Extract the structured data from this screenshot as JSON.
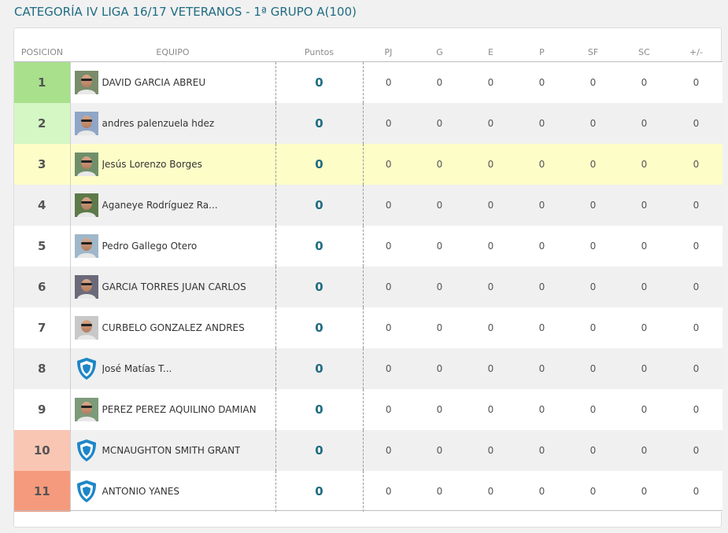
{
  "title": "CATEGORÍA IV LIGA 16/17 VETERANOS - 1ª GRUPO A(100)",
  "colors": {
    "title": "#1f6c82",
    "points": "#1f6c82",
    "highlight_row": "#fdfdc8",
    "pos_1": "#a9e08c",
    "pos_2": "#d4f7c4",
    "pos_10": "#f9c6b4",
    "pos_11": "#f59a7c"
  },
  "headers": {
    "posicion": "POSICION",
    "equipo": "EQUIPO",
    "puntos": "Puntos",
    "pj": "PJ",
    "g": "G",
    "e": "E",
    "p": "P",
    "sf": "SF",
    "sc": "SC",
    "diff": "+/-"
  },
  "rows": [
    {
      "pos": "1",
      "pos_bg": "#a9e08c",
      "team": "DAVID GARCIA ABREU",
      "avatar": "photo",
      "pts": "0",
      "pj": "0",
      "g": "0",
      "e": "0",
      "p": "0",
      "sf": "0",
      "sc": "0",
      "diff": "0",
      "style": ""
    },
    {
      "pos": "2",
      "pos_bg": "#d4f7c4",
      "team": "andres palenzuela hdez",
      "avatar": "photo",
      "pts": "0",
      "pj": "0",
      "g": "0",
      "e": "0",
      "p": "0",
      "sf": "0",
      "sc": "0",
      "diff": "0",
      "style": "alt"
    },
    {
      "pos": "3",
      "pos_bg": "",
      "team": "Jesús Lorenzo Borges",
      "avatar": "photo",
      "pts": "0",
      "pj": "0",
      "g": "0",
      "e": "0",
      "p": "0",
      "sf": "0",
      "sc": "0",
      "diff": "0",
      "style": "highlight"
    },
    {
      "pos": "4",
      "pos_bg": "",
      "team": "Aganeye Rodríguez Ra...",
      "avatar": "photo",
      "pts": "0",
      "pj": "0",
      "g": "0",
      "e": "0",
      "p": "0",
      "sf": "0",
      "sc": "0",
      "diff": "0",
      "style": "alt"
    },
    {
      "pos": "5",
      "pos_bg": "",
      "team": "Pedro Gallego Otero",
      "avatar": "photo",
      "pts": "0",
      "pj": "0",
      "g": "0",
      "e": "0",
      "p": "0",
      "sf": "0",
      "sc": "0",
      "diff": "0",
      "style": ""
    },
    {
      "pos": "6",
      "pos_bg": "",
      "team": "GARCIA TORRES JUAN CARLOS",
      "avatar": "photo",
      "pts": "0",
      "pj": "0",
      "g": "0",
      "e": "0",
      "p": "0",
      "sf": "0",
      "sc": "0",
      "diff": "0",
      "style": "alt"
    },
    {
      "pos": "7",
      "pos_bg": "",
      "team": "CURBELO GONZALEZ ANDRES",
      "avatar": "photo",
      "pts": "0",
      "pj": "0",
      "g": "0",
      "e": "0",
      "p": "0",
      "sf": "0",
      "sc": "0",
      "diff": "0",
      "style": ""
    },
    {
      "pos": "8",
      "pos_bg": "",
      "team": "José Matías T...",
      "avatar": "shield",
      "pts": "0",
      "pj": "0",
      "g": "0",
      "e": "0",
      "p": "0",
      "sf": "0",
      "sc": "0",
      "diff": "0",
      "style": "alt"
    },
    {
      "pos": "9",
      "pos_bg": "",
      "team": "PEREZ PEREZ AQUILINO DAMIAN",
      "avatar": "photo",
      "pts": "0",
      "pj": "0",
      "g": "0",
      "e": "0",
      "p": "0",
      "sf": "0",
      "sc": "0",
      "diff": "0",
      "style": ""
    },
    {
      "pos": "10",
      "pos_bg": "#f9c6b4",
      "team": "MCNAUGHTON SMITH GRANT",
      "avatar": "shield",
      "pts": "0",
      "pj": "0",
      "g": "0",
      "e": "0",
      "p": "0",
      "sf": "0",
      "sc": "0",
      "diff": "0",
      "style": "alt"
    },
    {
      "pos": "11",
      "pos_bg": "#f59a7c",
      "team": "ANTONIO YANES",
      "avatar": "shield",
      "pts": "0",
      "pj": "0",
      "g": "0",
      "e": "0",
      "p": "0",
      "sf": "0",
      "sc": "0",
      "diff": "0",
      "style": ""
    }
  ]
}
